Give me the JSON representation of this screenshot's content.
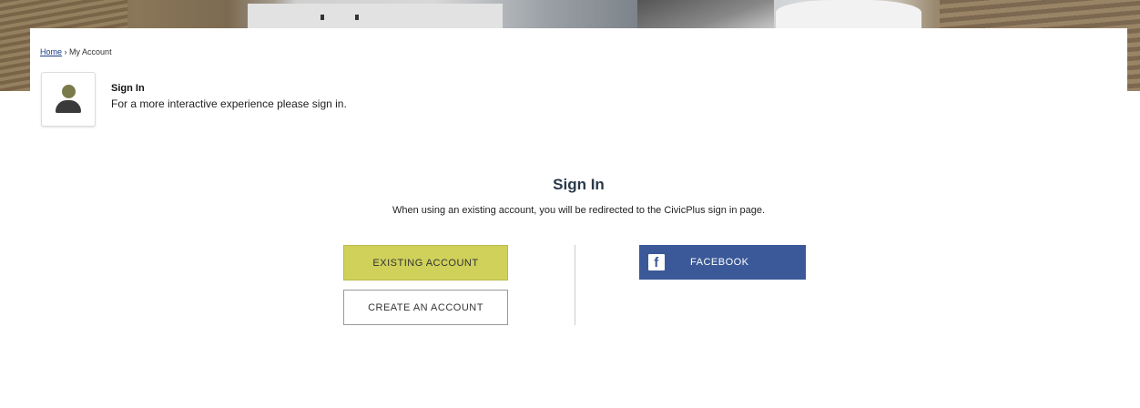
{
  "breadcrumb": {
    "home": "Home",
    "separator": "›",
    "current": "My Account"
  },
  "intro": {
    "title": "Sign In",
    "text": "For a more interactive experience please sign in."
  },
  "signin": {
    "title": "Sign In",
    "subtitle": "When using an existing account, you will be redirected to the CivicPlus sign in page.",
    "existing_label": "EXISTING ACCOUNT",
    "create_label": "CREATE AN ACCOUNT",
    "facebook_label": "FACEBOOK",
    "facebook_glyph": "f"
  },
  "colors": {
    "existing_bg": "#cfd15a",
    "facebook_bg": "#3b5998"
  },
  "icons": {
    "avatar": "user-avatar-icon",
    "facebook": "facebook-icon"
  }
}
